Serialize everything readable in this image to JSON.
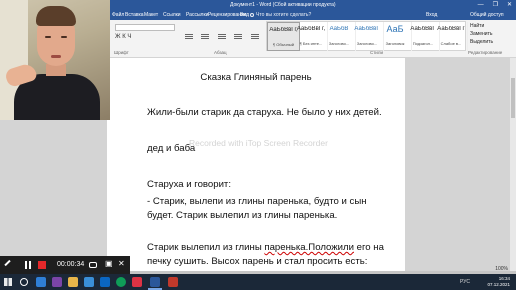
{
  "window": {
    "title": "Документ1 - Word (Сбой активации продукта)",
    "controls": [
      "—",
      "❐",
      "✕"
    ]
  },
  "ribbon_tabs": [
    {
      "label": "Файл"
    },
    {
      "label": "Вставка"
    },
    {
      "label": "Макет"
    },
    {
      "label": "Ссылки"
    },
    {
      "label": "Рассылки"
    },
    {
      "label": "Рецензирование"
    },
    {
      "label": "Вид"
    }
  ],
  "tell_me": "Что вы хотите сделать?",
  "sign_in": "Вход",
  "share": "Общий доступ",
  "ribbon": {
    "font_group": "Шрифт",
    "paragraph_group": "Абзац",
    "styles_group": "Стили",
    "editing_group": "Редактирование",
    "format_buttons": "Ж К Ч",
    "styles": [
      {
        "sample": "АаБбВвГг,",
        "name": "¶ Обычный"
      },
      {
        "sample": "АаБбВвГг,",
        "name": "¶ Без инте..."
      },
      {
        "sample": "АаБбВ",
        "name": "Заголово..."
      },
      {
        "sample": "АаБбВвГ",
        "name": "Заголово..."
      },
      {
        "sample": "АаБ",
        "name": "Заголовок"
      },
      {
        "sample": "АаБбВвГ",
        "name": "Подзагол..."
      },
      {
        "sample": "АаБбВвГг",
        "name": "Слабое в..."
      }
    ],
    "editing": [
      "Найти",
      "Заменить",
      "Выделить"
    ]
  },
  "document": {
    "title": "Сказка Глиняный парень",
    "line1": "Жили-были старик да старуха. Не было у них детей.",
    "line2": "дед и баба",
    "line3": "Старуха и говорит:",
    "line4": "- Старик, вылепи из глины паренька, будто и сын будет. Старик вылепил из глины паренька.",
    "line5_a": "Старик вылепил из глины ",
    "line5_b": "паренька.Положили",
    "line5_c": " его на печку сушить. Высох парень и стал просить есть:",
    "watermark": "Recorded with iTop Screen Recorder"
  },
  "recorder": {
    "elapsed": "00:00:34"
  },
  "zoom": "100%",
  "taskbar": {
    "time": "16:34",
    "date": "07.12.2021",
    "lang": "РУС"
  }
}
